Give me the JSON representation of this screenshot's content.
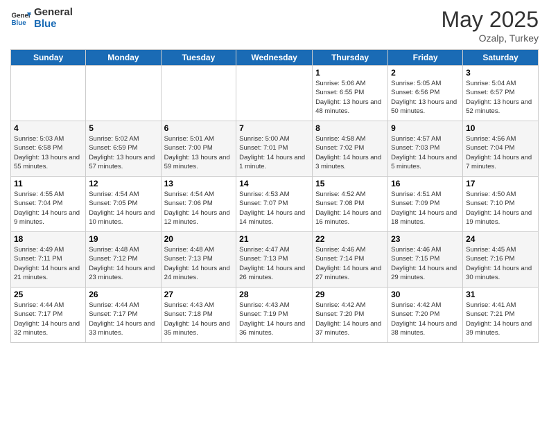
{
  "header": {
    "logo": "General Blue",
    "logo_general": "General",
    "logo_blue": "Blue",
    "month": "May 2025",
    "location": "Ozalp, Turkey"
  },
  "weekdays": [
    "Sunday",
    "Monday",
    "Tuesday",
    "Wednesday",
    "Thursday",
    "Friday",
    "Saturday"
  ],
  "rows": [
    [
      {
        "day": "",
        "info": ""
      },
      {
        "day": "",
        "info": ""
      },
      {
        "day": "",
        "info": ""
      },
      {
        "day": "",
        "info": ""
      },
      {
        "day": "1",
        "info": "Sunrise: 5:06 AM\nSunset: 6:55 PM\nDaylight: 13 hours\nand 48 minutes."
      },
      {
        "day": "2",
        "info": "Sunrise: 5:05 AM\nSunset: 6:56 PM\nDaylight: 13 hours\nand 50 minutes."
      },
      {
        "day": "3",
        "info": "Sunrise: 5:04 AM\nSunset: 6:57 PM\nDaylight: 13 hours\nand 52 minutes."
      }
    ],
    [
      {
        "day": "4",
        "info": "Sunrise: 5:03 AM\nSunset: 6:58 PM\nDaylight: 13 hours\nand 55 minutes."
      },
      {
        "day": "5",
        "info": "Sunrise: 5:02 AM\nSunset: 6:59 PM\nDaylight: 13 hours\nand 57 minutes."
      },
      {
        "day": "6",
        "info": "Sunrise: 5:01 AM\nSunset: 7:00 PM\nDaylight: 13 hours\nand 59 minutes."
      },
      {
        "day": "7",
        "info": "Sunrise: 5:00 AM\nSunset: 7:01 PM\nDaylight: 14 hours\nand 1 minute."
      },
      {
        "day": "8",
        "info": "Sunrise: 4:58 AM\nSunset: 7:02 PM\nDaylight: 14 hours\nand 3 minutes."
      },
      {
        "day": "9",
        "info": "Sunrise: 4:57 AM\nSunset: 7:03 PM\nDaylight: 14 hours\nand 5 minutes."
      },
      {
        "day": "10",
        "info": "Sunrise: 4:56 AM\nSunset: 7:04 PM\nDaylight: 14 hours\nand 7 minutes."
      }
    ],
    [
      {
        "day": "11",
        "info": "Sunrise: 4:55 AM\nSunset: 7:04 PM\nDaylight: 14 hours\nand 9 minutes."
      },
      {
        "day": "12",
        "info": "Sunrise: 4:54 AM\nSunset: 7:05 PM\nDaylight: 14 hours\nand 10 minutes."
      },
      {
        "day": "13",
        "info": "Sunrise: 4:54 AM\nSunset: 7:06 PM\nDaylight: 14 hours\nand 12 minutes."
      },
      {
        "day": "14",
        "info": "Sunrise: 4:53 AM\nSunset: 7:07 PM\nDaylight: 14 hours\nand 14 minutes."
      },
      {
        "day": "15",
        "info": "Sunrise: 4:52 AM\nSunset: 7:08 PM\nDaylight: 14 hours\nand 16 minutes."
      },
      {
        "day": "16",
        "info": "Sunrise: 4:51 AM\nSunset: 7:09 PM\nDaylight: 14 hours\nand 18 minutes."
      },
      {
        "day": "17",
        "info": "Sunrise: 4:50 AM\nSunset: 7:10 PM\nDaylight: 14 hours\nand 19 minutes."
      }
    ],
    [
      {
        "day": "18",
        "info": "Sunrise: 4:49 AM\nSunset: 7:11 PM\nDaylight: 14 hours\nand 21 minutes."
      },
      {
        "day": "19",
        "info": "Sunrise: 4:48 AM\nSunset: 7:12 PM\nDaylight: 14 hours\nand 23 minutes."
      },
      {
        "day": "20",
        "info": "Sunrise: 4:48 AM\nSunset: 7:13 PM\nDaylight: 14 hours\nand 24 minutes."
      },
      {
        "day": "21",
        "info": "Sunrise: 4:47 AM\nSunset: 7:13 PM\nDaylight: 14 hours\nand 26 minutes."
      },
      {
        "day": "22",
        "info": "Sunrise: 4:46 AM\nSunset: 7:14 PM\nDaylight: 14 hours\nand 27 minutes."
      },
      {
        "day": "23",
        "info": "Sunrise: 4:46 AM\nSunset: 7:15 PM\nDaylight: 14 hours\nand 29 minutes."
      },
      {
        "day": "24",
        "info": "Sunrise: 4:45 AM\nSunset: 7:16 PM\nDaylight: 14 hours\nand 30 minutes."
      }
    ],
    [
      {
        "day": "25",
        "info": "Sunrise: 4:44 AM\nSunset: 7:17 PM\nDaylight: 14 hours\nand 32 minutes."
      },
      {
        "day": "26",
        "info": "Sunrise: 4:44 AM\nSunset: 7:17 PM\nDaylight: 14 hours\nand 33 minutes."
      },
      {
        "day": "27",
        "info": "Sunrise: 4:43 AM\nSunset: 7:18 PM\nDaylight: 14 hours\nand 35 minutes."
      },
      {
        "day": "28",
        "info": "Sunrise: 4:43 AM\nSunset: 7:19 PM\nDaylight: 14 hours\nand 36 minutes."
      },
      {
        "day": "29",
        "info": "Sunrise: 4:42 AM\nSunset: 7:20 PM\nDaylight: 14 hours\nand 37 minutes."
      },
      {
        "day": "30",
        "info": "Sunrise: 4:42 AM\nSunset: 7:20 PM\nDaylight: 14 hours\nand 38 minutes."
      },
      {
        "day": "31",
        "info": "Sunrise: 4:41 AM\nSunset: 7:21 PM\nDaylight: 14 hours\nand 39 minutes."
      }
    ]
  ]
}
